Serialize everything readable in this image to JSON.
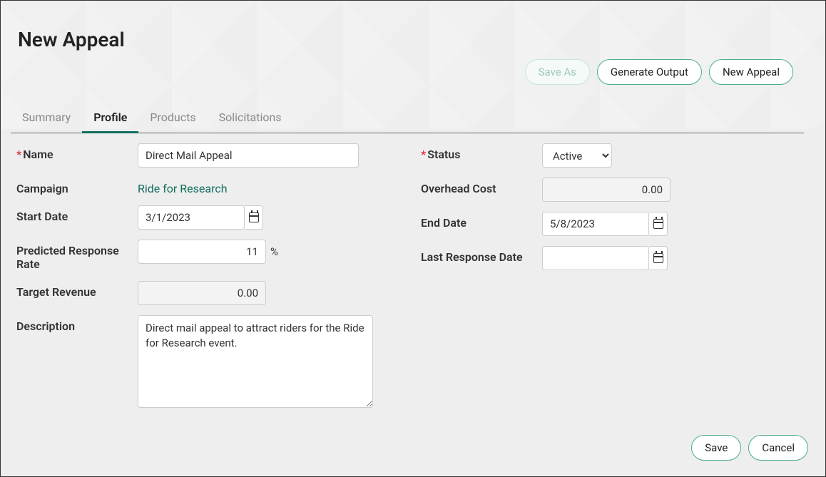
{
  "title": "New Appeal",
  "header_buttons": {
    "save_as": "Save As",
    "generate_output": "Generate Output",
    "new_appeal": "New Appeal"
  },
  "tabs": [
    "Summary",
    "Profile",
    "Products",
    "Solicitations"
  ],
  "active_tab": 1,
  "labels": {
    "name": "Name",
    "campaign": "Campaign",
    "start_date": "Start Date",
    "predicted_response_rate": "Predicted Response Rate",
    "target_revenue": "Target Revenue",
    "description": "Description",
    "status": "Status",
    "overhead_cost": "Overhead Cost",
    "end_date": "End Date",
    "last_response_date": "Last Response Date"
  },
  "values": {
    "name": "Direct Mail Appeal",
    "campaign_link": "Ride for Research",
    "start_date": "3/1/2023",
    "predicted_response_rate": "11",
    "predicted_response_suffix": "%",
    "target_revenue": "0.00",
    "description": "Direct mail appeal to attract riders for the Ride for Research event.",
    "status": "Active",
    "overhead_cost": "0.00",
    "end_date": "5/8/2023",
    "last_response_date": ""
  },
  "status_options": [
    "Active"
  ],
  "footer": {
    "save": "Save",
    "cancel": "Cancel"
  }
}
